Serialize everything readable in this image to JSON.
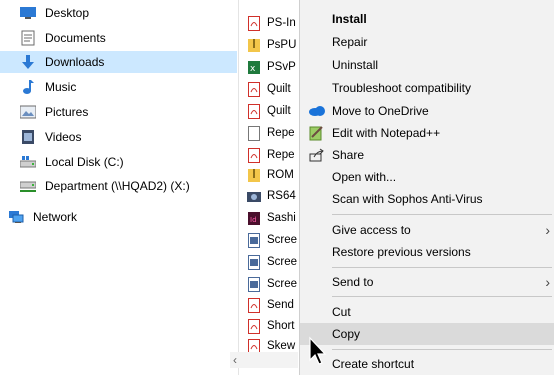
{
  "sidebar": {
    "items": [
      {
        "label": "Desktop",
        "icon": "desktop-icon"
      },
      {
        "label": "Documents",
        "icon": "documents-icon"
      },
      {
        "label": "Downloads",
        "icon": "downloads-icon"
      },
      {
        "label": "Music",
        "icon": "music-icon"
      },
      {
        "label": "Pictures",
        "icon": "pictures-icon"
      },
      {
        "label": "Videos",
        "icon": "videos-icon"
      },
      {
        "label": "Local Disk (C:)",
        "icon": "drive-icon"
      },
      {
        "label": "Department (\\\\HQAD2) (X:)",
        "icon": "network-drive-icon"
      },
      {
        "label": "Network",
        "icon": "network-icon"
      }
    ]
  },
  "files": [
    {
      "name": "PS-In",
      "type": "pdf"
    },
    {
      "name": "PsPU",
      "type": "zip"
    },
    {
      "name": "PSvP",
      "type": "excel"
    },
    {
      "name": "Quilt",
      "type": "pdf"
    },
    {
      "name": "Quilt",
      "type": "pdf"
    },
    {
      "name": "Repe",
      "type": "text"
    },
    {
      "name": "Repe",
      "type": "pdf"
    },
    {
      "name": "ROM",
      "type": "zip"
    },
    {
      "name": "RS64",
      "type": "installer"
    },
    {
      "name": "Sashi",
      "type": "indesign"
    },
    {
      "name": "Scree",
      "type": "image"
    },
    {
      "name": "Scree",
      "type": "image"
    },
    {
      "name": "Scree",
      "type": "image"
    },
    {
      "name": "Send",
      "type": "pdf"
    },
    {
      "name": "Short",
      "type": "pdf"
    },
    {
      "name": "Skew",
      "type": "pdf"
    }
  ],
  "context_menu": {
    "install": "Install",
    "repair": "Repair",
    "uninstall": "Uninstall",
    "troubleshoot": "Troubleshoot compatibility",
    "move_onedrive": "Move to OneDrive",
    "edit_notepad": "Edit with Notepad++",
    "share": "Share",
    "open_with": "Open with...",
    "scan_sophos": "Scan with Sophos Anti-Virus",
    "give_access": "Give access to",
    "restore_prev": "Restore previous versions",
    "send_to": "Send to",
    "cut": "Cut",
    "copy": "Copy",
    "create_shortcut": "Create shortcut"
  },
  "colors": {
    "selected_bg": "#cce8ff",
    "menu_bg": "#f2f2f2",
    "menu_hover": "#dadada",
    "pdf_red": "#d0302a",
    "onedrive_blue": "#1a73d9"
  }
}
